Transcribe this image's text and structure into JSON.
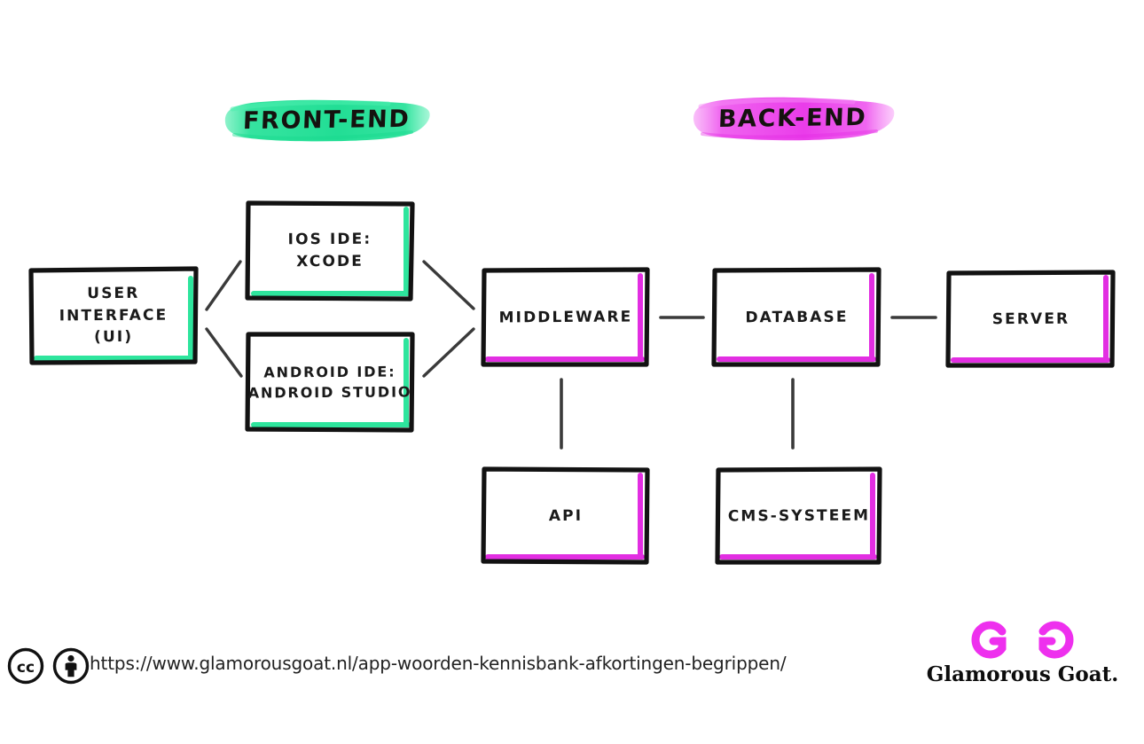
{
  "diagram": {
    "title": "App architecture: front-end and back-end",
    "colors": {
      "frontend_accent": "#2EE59D",
      "backend_accent": "#E22EE2",
      "ink": "#1a1a1a",
      "background": "#ffffff"
    },
    "banners": [
      {
        "id": "frontend",
        "label": "FRONT-END",
        "color": "#2EE59D"
      },
      {
        "id": "backend",
        "label": "BACK-END",
        "color": "#EE55EE"
      }
    ],
    "nodes": [
      {
        "id": "ui",
        "label": "USER\nINTERFACE\n(UI)",
        "group": "front-end",
        "accent": "#2EE59D"
      },
      {
        "id": "ios",
        "label": "IOS IDE:\nXCODE",
        "group": "front-end",
        "accent": "#2EE59D"
      },
      {
        "id": "android",
        "label": "ANDROID IDE:\nANDROID STUDIO",
        "group": "front-end",
        "accent": "#2EE59D"
      },
      {
        "id": "middleware",
        "label": "MIDDLEWARE",
        "group": "back-end",
        "accent": "#E22EE2"
      },
      {
        "id": "database",
        "label": "DATABASE",
        "group": "back-end",
        "accent": "#E22EE2"
      },
      {
        "id": "server",
        "label": "SERVER",
        "group": "back-end",
        "accent": "#E22EE2"
      },
      {
        "id": "api",
        "label": "API",
        "group": "back-end",
        "accent": "#E22EE2"
      },
      {
        "id": "cms",
        "label": "CMS-SYSTEEM",
        "group": "back-end",
        "accent": "#E22EE2"
      }
    ],
    "edges": [
      {
        "from": "ui",
        "to": "ios",
        "style": "diagonal"
      },
      {
        "from": "ui",
        "to": "android",
        "style": "diagonal"
      },
      {
        "from": "ios",
        "to": "middleware",
        "style": "diagonal"
      },
      {
        "from": "android",
        "to": "middleware",
        "style": "diagonal"
      },
      {
        "from": "middleware",
        "to": "database",
        "style": "horizontal"
      },
      {
        "from": "database",
        "to": "server",
        "style": "horizontal"
      },
      {
        "from": "middleware",
        "to": "api",
        "style": "vertical"
      },
      {
        "from": "database",
        "to": "cms",
        "style": "vertical"
      }
    ]
  },
  "footer": {
    "license": {
      "cc_label": "cc",
      "by_label": "by-person"
    },
    "url": "https://www.glamorousgoat.nl/app-woorden-kennisbank-afkortingen-begrippen/",
    "brand": {
      "name": "Glamorous Goat.",
      "mark_color": "#EE30EE"
    }
  }
}
